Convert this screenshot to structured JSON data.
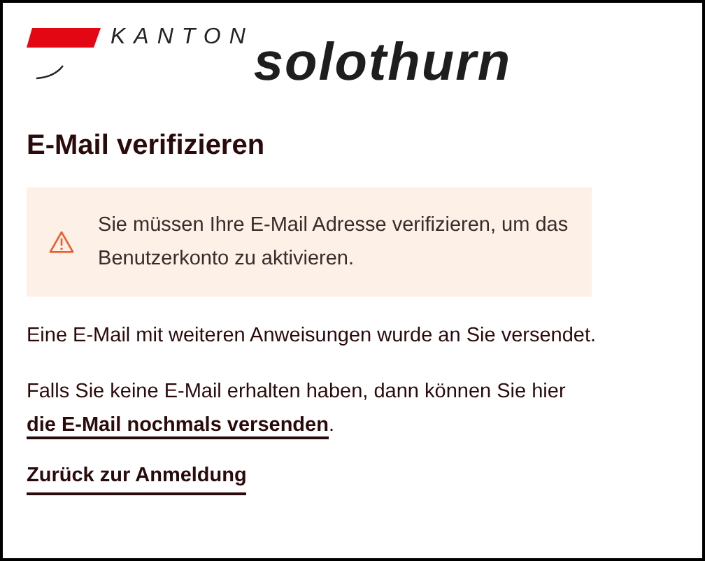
{
  "logo": {
    "prefix": "KANTON",
    "name": "solothurn"
  },
  "title": "E-Mail verifizieren",
  "alert": {
    "kind": "warning",
    "text": "Sie müssen Ihre E-Mail Adresse verifizieren, um das Benutzerkonto zu aktivieren."
  },
  "paragraphs": [
    {
      "text": "Eine E-Mail mit weiteren Anweisungen wurde an Sie versendet."
    },
    {
      "text": "Falls Sie keine E-Mail erhalten haben, dann können Sie hier ",
      "link": "die E-Mail nochmals versenden",
      "after": "."
    }
  ],
  "back_link": "Zurück zur Anmeldung"
}
